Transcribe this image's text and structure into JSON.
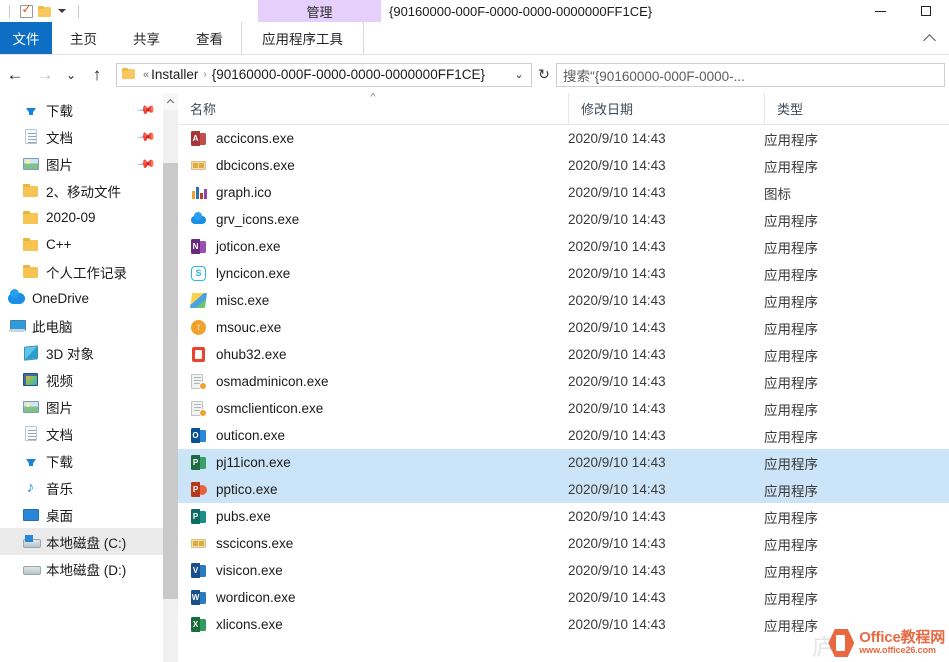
{
  "window": {
    "title": "{90160000-000F-0000-0000-0000000FF1CE}",
    "minimize_label": "—",
    "maximize_label": "□"
  },
  "quick_access": {
    "properties_icon": "properties-checkbox-icon",
    "new_folder_icon": "new-folder-icon",
    "customize_icon": "chevron-down-icon"
  },
  "ribbon": {
    "contextual_group_label": "管理",
    "tabs": [
      {
        "label": "文件",
        "id": "file"
      },
      {
        "label": "主页",
        "id": "home"
      },
      {
        "label": "共享",
        "id": "share"
      },
      {
        "label": "查看",
        "id": "view"
      },
      {
        "label": "应用程序工具",
        "id": "application-tools"
      }
    ],
    "collapse_icon": "chevron-up-icon"
  },
  "address": {
    "back_icon": "←",
    "forward_icon": "→",
    "recent_icon": "⌄",
    "up_icon": "↑",
    "folder_icon": "folder-icon",
    "overflow": "«",
    "crumbs": [
      "Installer",
      "{90160000-000F-0000-0000-0000000FF1CE}"
    ],
    "separator": "›",
    "dropdown_icon": "⌄",
    "refresh_icon": "↻"
  },
  "search": {
    "placeholder": "搜索\"{90160000-000F-0000-..."
  },
  "sidebar": {
    "items": [
      {
        "label": "下载",
        "icon": "download-icon",
        "pinned": true,
        "level": 1,
        "selected": false
      },
      {
        "label": "文档",
        "icon": "document-icon",
        "pinned": true,
        "level": 1,
        "selected": false
      },
      {
        "label": "图片",
        "icon": "pictures-icon",
        "pinned": true,
        "level": 1,
        "selected": false
      },
      {
        "label": "2、移动文件",
        "icon": "folder-icon",
        "pinned": false,
        "level": 1,
        "selected": false
      },
      {
        "label": "2020-09",
        "icon": "folder-icon",
        "pinned": false,
        "level": 1,
        "selected": false
      },
      {
        "label": "C++",
        "icon": "folder-icon",
        "pinned": false,
        "level": 1,
        "selected": false
      },
      {
        "label": "个人工作记录",
        "icon": "folder-icon",
        "pinned": false,
        "level": 1,
        "selected": false
      },
      {
        "label": "OneDrive",
        "icon": "onedrive-icon",
        "pinned": false,
        "level": 0,
        "selected": false
      },
      {
        "label": "此电脑",
        "icon": "this-pc-icon",
        "pinned": false,
        "level": 0,
        "selected": false
      },
      {
        "label": "3D 对象",
        "icon": "3d-objects-icon",
        "pinned": false,
        "level": 1,
        "selected": false
      },
      {
        "label": "视频",
        "icon": "videos-icon",
        "pinned": false,
        "level": 1,
        "selected": false
      },
      {
        "label": "图片",
        "icon": "pictures-icon",
        "pinned": false,
        "level": 1,
        "selected": false
      },
      {
        "label": "文档",
        "icon": "document-icon",
        "pinned": false,
        "level": 1,
        "selected": false
      },
      {
        "label": "下载",
        "icon": "download-icon",
        "pinned": false,
        "level": 1,
        "selected": false
      },
      {
        "label": "音乐",
        "icon": "music-icon",
        "pinned": false,
        "level": 1,
        "selected": false
      },
      {
        "label": "桌面",
        "icon": "desktop-icon",
        "pinned": false,
        "level": 1,
        "selected": false
      },
      {
        "label": "本地磁盘 (C:)",
        "icon": "disk-c-icon",
        "pinned": false,
        "level": 1,
        "selected": true
      },
      {
        "label": "本地磁盘 (D:)",
        "icon": "disk-icon",
        "pinned": false,
        "level": 1,
        "selected": false
      }
    ],
    "scroll_up_icon": "chevron-up-icon"
  },
  "filelist": {
    "columns": [
      {
        "label": "名称",
        "id": "name",
        "sorted": true,
        "sort_icon": "^"
      },
      {
        "label": "修改日期",
        "id": "date",
        "sorted": false,
        "sort_icon": ""
      },
      {
        "label": "类型",
        "id": "type",
        "sorted": false,
        "sort_icon": ""
      }
    ],
    "rows": [
      {
        "name": "accicons.exe",
        "date": "2020/9/10 14:43",
        "type": "应用程序",
        "icon": "access-icon",
        "selected": false
      },
      {
        "name": "dbcicons.exe",
        "date": "2020/9/10 14:43",
        "type": "应用程序",
        "icon": "dbcicons-icon",
        "selected": false
      },
      {
        "name": "graph.ico",
        "date": "2020/9/10 14:43",
        "type": "图标",
        "icon": "graph-icon",
        "selected": false
      },
      {
        "name": "grv_icons.exe",
        "date": "2020/9/10 14:43",
        "type": "应用程序",
        "icon": "groove-cloud-icon",
        "selected": false
      },
      {
        "name": "joticon.exe",
        "date": "2020/9/10 14:43",
        "type": "应用程序",
        "icon": "onenote-icon",
        "selected": false
      },
      {
        "name": "lyncicon.exe",
        "date": "2020/9/10 14:43",
        "type": "应用程序",
        "icon": "skype-icon",
        "selected": false
      },
      {
        "name": "misc.exe",
        "date": "2020/9/10 14:43",
        "type": "应用程序",
        "icon": "misc-flag-icon",
        "selected": false
      },
      {
        "name": "msouc.exe",
        "date": "2020/9/10 14:43",
        "type": "应用程序",
        "icon": "upload-center-icon",
        "selected": false
      },
      {
        "name": "ohub32.exe",
        "date": "2020/9/10 14:43",
        "type": "应用程序",
        "icon": "office-hub-icon",
        "selected": false
      },
      {
        "name": "osmadminicon.exe",
        "date": "2020/9/10 14:43",
        "type": "应用程序",
        "icon": "osm-admin-icon",
        "selected": false
      },
      {
        "name": "osmclienticon.exe",
        "date": "2020/9/10 14:43",
        "type": "应用程序",
        "icon": "osm-client-icon",
        "selected": false
      },
      {
        "name": "outicon.exe",
        "date": "2020/9/10 14:43",
        "type": "应用程序",
        "icon": "outlook-icon",
        "selected": false
      },
      {
        "name": "pj11icon.exe",
        "date": "2020/9/10 14:43",
        "type": "应用程序",
        "icon": "project-icon",
        "selected": true
      },
      {
        "name": "pptico.exe",
        "date": "2020/9/10 14:43",
        "type": "应用程序",
        "icon": "powerpoint-icon",
        "selected": true
      },
      {
        "name": "pubs.exe",
        "date": "2020/9/10 14:43",
        "type": "应用程序",
        "icon": "publisher-icon",
        "selected": false
      },
      {
        "name": "sscicons.exe",
        "date": "2020/9/10 14:43",
        "type": "应用程序",
        "icon": "dbcicons-icon",
        "selected": false
      },
      {
        "name": "visicon.exe",
        "date": "2020/9/10 14:43",
        "type": "应用程序",
        "icon": "visio-icon",
        "selected": false
      },
      {
        "name": "wordicon.exe",
        "date": "2020/9/10 14:43",
        "type": "应用程序",
        "icon": "word-icon",
        "selected": false
      },
      {
        "name": "xlicons.exe",
        "date": "2020/9/10 14:43",
        "type": "应用程序",
        "icon": "excel-icon",
        "selected": false
      }
    ]
  },
  "watermark": {
    "title": "Office教程网",
    "url": "www.office26.com"
  },
  "colors": {
    "file_tab_blue": "#0d6fc4",
    "contextual_purple": "#e6cffb",
    "selection_blue": "#cce4f7",
    "sidebar_selected": "#eaeaea",
    "accent_orange": "#e8643c"
  }
}
